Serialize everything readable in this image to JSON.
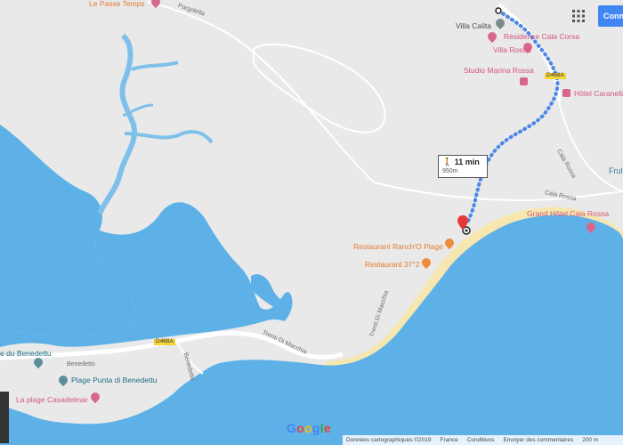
{
  "top_left_label": "Le Passe Temps",
  "road_labels": {
    "top_road": "Pargolella",
    "d468a_top": "D468A",
    "d468a_bottom": "D468A",
    "cala_rossa_1": "Cala Rossa",
    "cala_rossa_2": "Cala Rossa",
    "benedetto_1": "Benedetto",
    "benedetto_2": "Benedetto",
    "trenta_1": "Trenti Di Macchia",
    "trenta_2": "Trenti Di Macchia"
  },
  "places": {
    "villa_calita": "Villa Calita",
    "residence": "Résidence Cala Corsa",
    "villa_rossa": "Villa Rossa",
    "studio": "Studio Marina Rossa",
    "hotel_caranella": "Hôtel Caranella",
    "grand_hotel": "Grand Hôtel Cala Rossa",
    "restaurant_ranch": "Restaurant Ranch'O Plage",
    "restaurant_37": "Restaurant 37°2",
    "benedettu": "e du Benedettu",
    "plage_punta": "Plage Punta di Benedettu",
    "plage_casadelmar": "La plage Casadelmar",
    "fruli": "Frul"
  },
  "route": {
    "duration": "11 min",
    "distance": "950m",
    "mode_icon": "walking-icon"
  },
  "controls": {
    "connect_label": "Conne",
    "apps_icon": "apps-grid-icon"
  },
  "footer": {
    "data_credit": "Données cartographiques ©2019",
    "region": "France",
    "conditions": "Conditions",
    "feedback": "Envoyer des commentaires",
    "scale": "200 m"
  },
  "logo": "Google",
  "colors": {
    "land": "#e9e9e9",
    "water": "#5eb1e6",
    "beach": "#f6e7b0",
    "route": "#4a86e8",
    "poi_pink": "#d9668d",
    "restaurant_orange": "#e47b2f"
  }
}
